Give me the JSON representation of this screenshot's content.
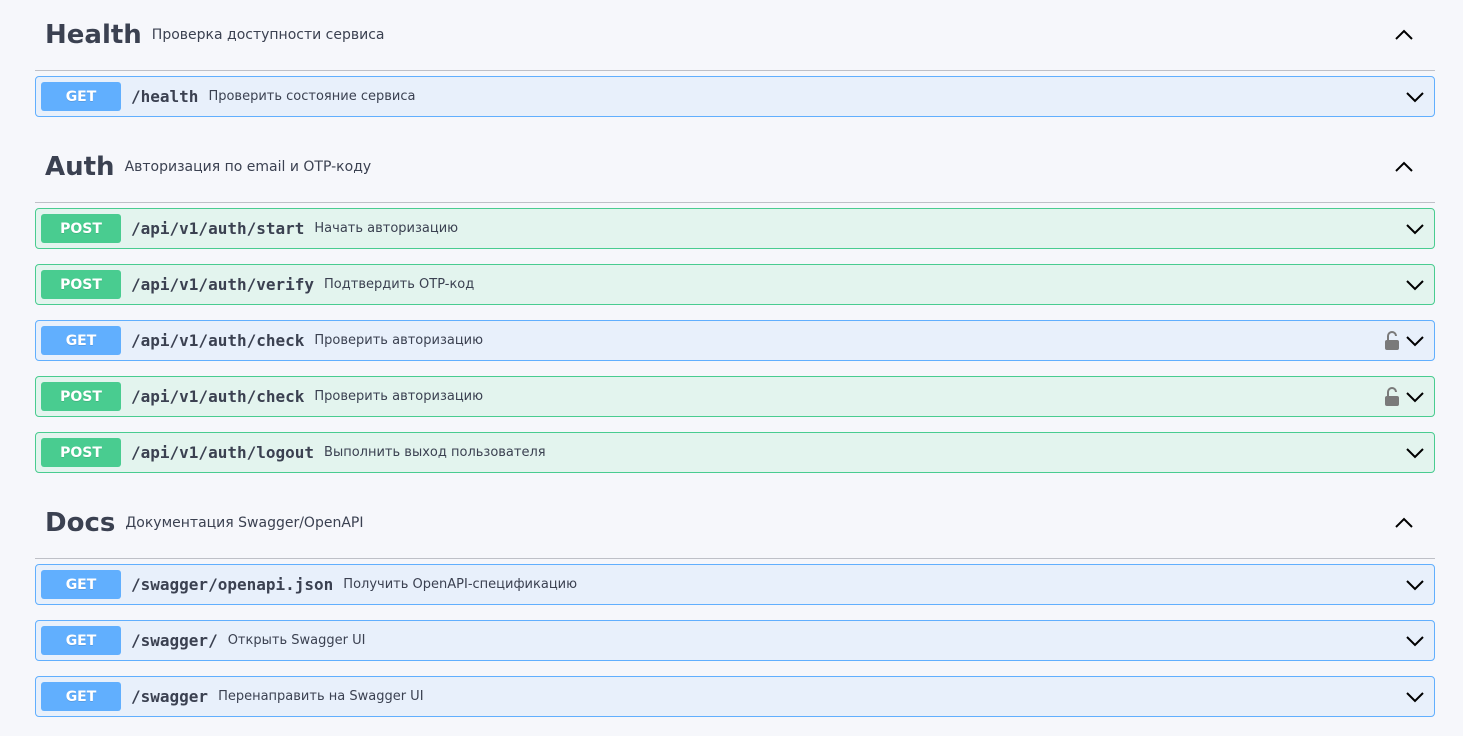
{
  "sections": [
    {
      "name": "Health",
      "description": "Проверка доступности сервиса",
      "operations": [
        {
          "method": "GET",
          "path": "/health",
          "summary": "Проверить состояние сервиса",
          "locked": false
        }
      ]
    },
    {
      "name": "Auth",
      "description": "Авторизация по email и OTP-коду",
      "operations": [
        {
          "method": "POST",
          "path": "/api/v1/auth/start",
          "summary": "Начать авторизацию",
          "locked": false
        },
        {
          "method": "POST",
          "path": "/api/v1/auth/verify",
          "summary": "Подтвердить OTP-код",
          "locked": false
        },
        {
          "method": "GET",
          "path": "/api/v1/auth/check",
          "summary": "Проверить авторизацию",
          "locked": true
        },
        {
          "method": "POST",
          "path": "/api/v1/auth/check",
          "summary": "Проверить авторизацию",
          "locked": true
        },
        {
          "method": "POST",
          "path": "/api/v1/auth/logout",
          "summary": "Выполнить выход пользователя",
          "locked": false
        }
      ]
    },
    {
      "name": "Docs",
      "description": "Документация Swagger/OpenAPI",
      "operations": [
        {
          "method": "GET",
          "path": "/swagger/openapi.json",
          "summary": "Получить OpenAPI-спецификацию",
          "locked": false
        },
        {
          "method": "GET",
          "path": "/swagger/",
          "summary": "Открыть Swagger UI",
          "locked": false
        },
        {
          "method": "GET",
          "path": "/swagger",
          "summary": "Перенаправить на Swagger UI",
          "locked": false
        }
      ]
    }
  ],
  "colors": {
    "get": "#61affe",
    "post": "#49cc90",
    "text": "#3b4151"
  },
  "icons": {
    "collapse": "chevron-up-icon",
    "expand": "chevron-down-icon",
    "lock": "lock-open-icon"
  }
}
